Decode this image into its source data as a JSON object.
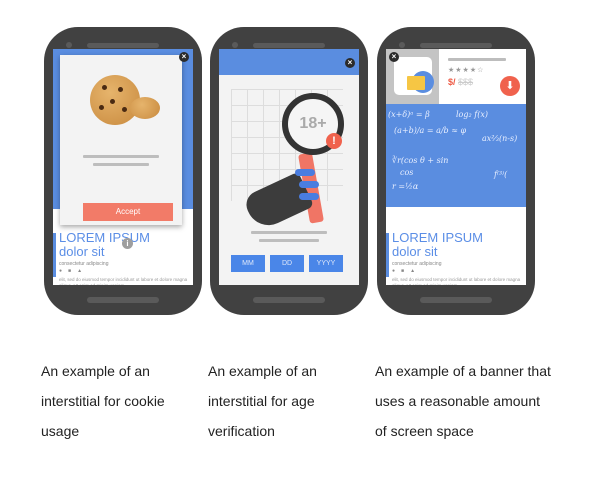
{
  "phones": [
    {
      "id": "cookie-interstitial",
      "dialog": {
        "button_label": "Accept",
        "close_glyph": "×",
        "info_glyph": "i"
      },
      "article": {
        "title_line1": "LOREM IPSUM",
        "title_line2": "dolor sit",
        "subtitle": "consectetur adipiscing",
        "icons": [
          "eye-icon",
          "video-icon",
          "lock-icon"
        ],
        "body": "elit, sed do eiusmod tempor incididunt ut labore et dolore magna aliqua. Ut enim ad minim veniam"
      },
      "caption": "An example of an interstitial for cookie usage"
    },
    {
      "id": "age-interstitial",
      "dialog": {
        "badge": "18+",
        "warning_glyph": "!",
        "close_glyph": "×",
        "fields": [
          "MM",
          "DD",
          "YYYY"
        ]
      },
      "caption": "An example of an interstitial for age verification"
    },
    {
      "id": "reasonable-banner",
      "banner": {
        "rating_stars": "★★★★☆",
        "rating": 4,
        "rating_max": 5,
        "price": "$/",
        "price_original": "$$$",
        "close_glyph": "×",
        "download_glyph": "⬇"
      },
      "chalk": [
        "(x+δ)ᵃ = β",
        "log₂ f(x)",
        "(a+b)/a = a/b ≈ φ",
        "ax⅔(n-s)",
        "∛r(cos θ + sin",
        "cos",
        "f⁽³⁾(",
        "r =½α"
      ],
      "article": {
        "title_line1": "LOREM IPSUM",
        "title_line2": "dolor sit",
        "subtitle": "consectetur adipiscing",
        "icons": [
          "eye-icon",
          "video-icon",
          "lock-icon"
        ],
        "body": "elit, sed do eiusmod tempor incididunt ut labore et dolore magna aliqua. Ut enim ad minim veniam"
      },
      "caption": "An example of a banner that uses a reasonable amount of screen space"
    }
  ],
  "colors": {
    "accent_blue": "#5a8de0",
    "accept_red": "#f27b68",
    "phone_body": "#414141"
  }
}
